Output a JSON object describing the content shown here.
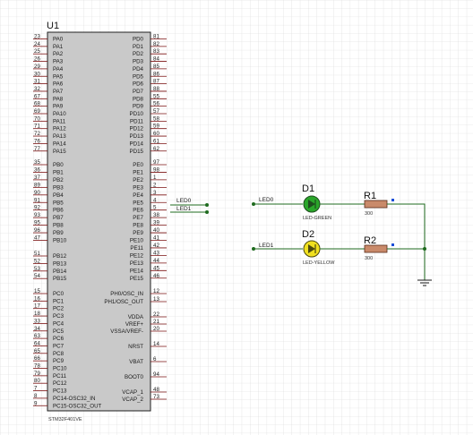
{
  "colors": {
    "grid": "#d7d7d7",
    "background": "#ffffff",
    "chip_fill": "#c9c9c9",
    "chip_border": "#202020",
    "pin_line": "#7a1010",
    "wire": "#1f6b1f",
    "led_green": "#2aa62a",
    "led_yellow": "#f0e020",
    "resistor_fill": "#c98a6a",
    "selection_marker": "#1a4dd8"
  },
  "mcu": {
    "ref": "U1",
    "part": "STM32F401VE",
    "left_pins": [
      {
        "num": "23",
        "name": "PA0"
      },
      {
        "num": "24",
        "name": "PA1"
      },
      {
        "num": "25",
        "name": "PA2"
      },
      {
        "num": "26",
        "name": "PA3"
      },
      {
        "num": "29",
        "name": "PA4"
      },
      {
        "num": "30",
        "name": "PA5"
      },
      {
        "num": "31",
        "name": "PA6"
      },
      {
        "num": "32",
        "name": "PA7"
      },
      {
        "num": "67",
        "name": "PA8"
      },
      {
        "num": "68",
        "name": "PA9"
      },
      {
        "num": "69",
        "name": "PA10"
      },
      {
        "num": "70",
        "name": "PA11"
      },
      {
        "num": "71",
        "name": "PA12"
      },
      {
        "num": "72",
        "name": "PA13"
      },
      {
        "num": "76",
        "name": "PA14"
      },
      {
        "num": "77",
        "name": "PA15"
      },
      {
        "num": "35",
        "name": "PB0"
      },
      {
        "num": "36",
        "name": "PB1"
      },
      {
        "num": "37",
        "name": "PB2"
      },
      {
        "num": "89",
        "name": "PB3"
      },
      {
        "num": "90",
        "name": "PB4"
      },
      {
        "num": "91",
        "name": "PB5"
      },
      {
        "num": "92",
        "name": "PB6"
      },
      {
        "num": "93",
        "name": "PB7"
      },
      {
        "num": "95",
        "name": "PB8"
      },
      {
        "num": "96",
        "name": "PB9"
      },
      {
        "num": "47",
        "name": "PB10"
      },
      {
        "num": "51",
        "name": "PB12"
      },
      {
        "num": "52",
        "name": "PB13"
      },
      {
        "num": "53",
        "name": "PB14"
      },
      {
        "num": "54",
        "name": "PB15"
      },
      {
        "num": "15",
        "name": "PC0"
      },
      {
        "num": "16",
        "name": "PC1"
      },
      {
        "num": "17",
        "name": "PC2"
      },
      {
        "num": "18",
        "name": "PC3"
      },
      {
        "num": "33",
        "name": "PC4"
      },
      {
        "num": "34",
        "name": "PC5"
      },
      {
        "num": "63",
        "name": "PC6"
      },
      {
        "num": "64",
        "name": "PC7"
      },
      {
        "num": "65",
        "name": "PC8"
      },
      {
        "num": "66",
        "name": "PC9"
      },
      {
        "num": "78",
        "name": "PC10"
      },
      {
        "num": "79",
        "name": "PC11"
      },
      {
        "num": "80",
        "name": "PC12"
      },
      {
        "num": "7",
        "name": "PC13"
      },
      {
        "num": "8",
        "name": "PC14-OSC32_IN"
      },
      {
        "num": "9",
        "name": "PC15-OSC32_OUT"
      }
    ],
    "right_pins": [
      {
        "num": "81",
        "name": "PD0"
      },
      {
        "num": "82",
        "name": "PD1"
      },
      {
        "num": "83",
        "name": "PD2"
      },
      {
        "num": "84",
        "name": "PD3"
      },
      {
        "num": "85",
        "name": "PD4"
      },
      {
        "num": "86",
        "name": "PD5"
      },
      {
        "num": "87",
        "name": "PD6"
      },
      {
        "num": "88",
        "name": "PD7"
      },
      {
        "num": "55",
        "name": "PD8"
      },
      {
        "num": "56",
        "name": "PD9"
      },
      {
        "num": "57",
        "name": "PD10"
      },
      {
        "num": "58",
        "name": "PD11"
      },
      {
        "num": "59",
        "name": "PD12"
      },
      {
        "num": "60",
        "name": "PD13"
      },
      {
        "num": "61",
        "name": "PD14"
      },
      {
        "num": "62",
        "name": "PD15"
      },
      {
        "num": "97",
        "name": "PE0"
      },
      {
        "num": "98",
        "name": "PE1"
      },
      {
        "num": "1",
        "name": "PE2"
      },
      {
        "num": "2",
        "name": "PE3"
      },
      {
        "num": "3",
        "name": "PE4"
      },
      {
        "num": "4",
        "name": "PE5"
      },
      {
        "num": "5",
        "name": "PE6"
      },
      {
        "num": "38",
        "name": "PE7"
      },
      {
        "num": "39",
        "name": "PE8"
      },
      {
        "num": "40",
        "name": "PE9"
      },
      {
        "num": "41",
        "name": "PE10"
      },
      {
        "num": "42",
        "name": "PE11"
      },
      {
        "num": "43",
        "name": "PE12"
      },
      {
        "num": "44",
        "name": "PE13"
      },
      {
        "num": "45",
        "name": "PE14"
      },
      {
        "num": "46",
        "name": "PE15"
      },
      {
        "num": "12",
        "name": "PH0/OSC_IN"
      },
      {
        "num": "13",
        "name": "PH1/OSC_OUT"
      },
      {
        "num": "22",
        "name": "VDDA"
      },
      {
        "num": "21",
        "name": "VREF+"
      },
      {
        "num": "20",
        "name": "VSSA/VREF-"
      },
      {
        "num": "14",
        "name": "NRST"
      },
      {
        "num": "6",
        "name": "VBAT"
      },
      {
        "num": "94",
        "name": "BOOT0"
      },
      {
        "num": "48",
        "name": "VCAP_1"
      },
      {
        "num": "73",
        "name": "VCAP_2"
      }
    ]
  },
  "nets": {
    "pe5": "LED0",
    "pe6": "LED1",
    "d1_in": "LED0",
    "d2_in": "LED1"
  },
  "d1": {
    "ref": "D1",
    "type": "LED-GREEN"
  },
  "d2": {
    "ref": "D2",
    "type": "LED-YELLOW"
  },
  "r1": {
    "ref": "R1",
    "value": "300"
  },
  "r2": {
    "ref": "R2",
    "value": "300"
  }
}
